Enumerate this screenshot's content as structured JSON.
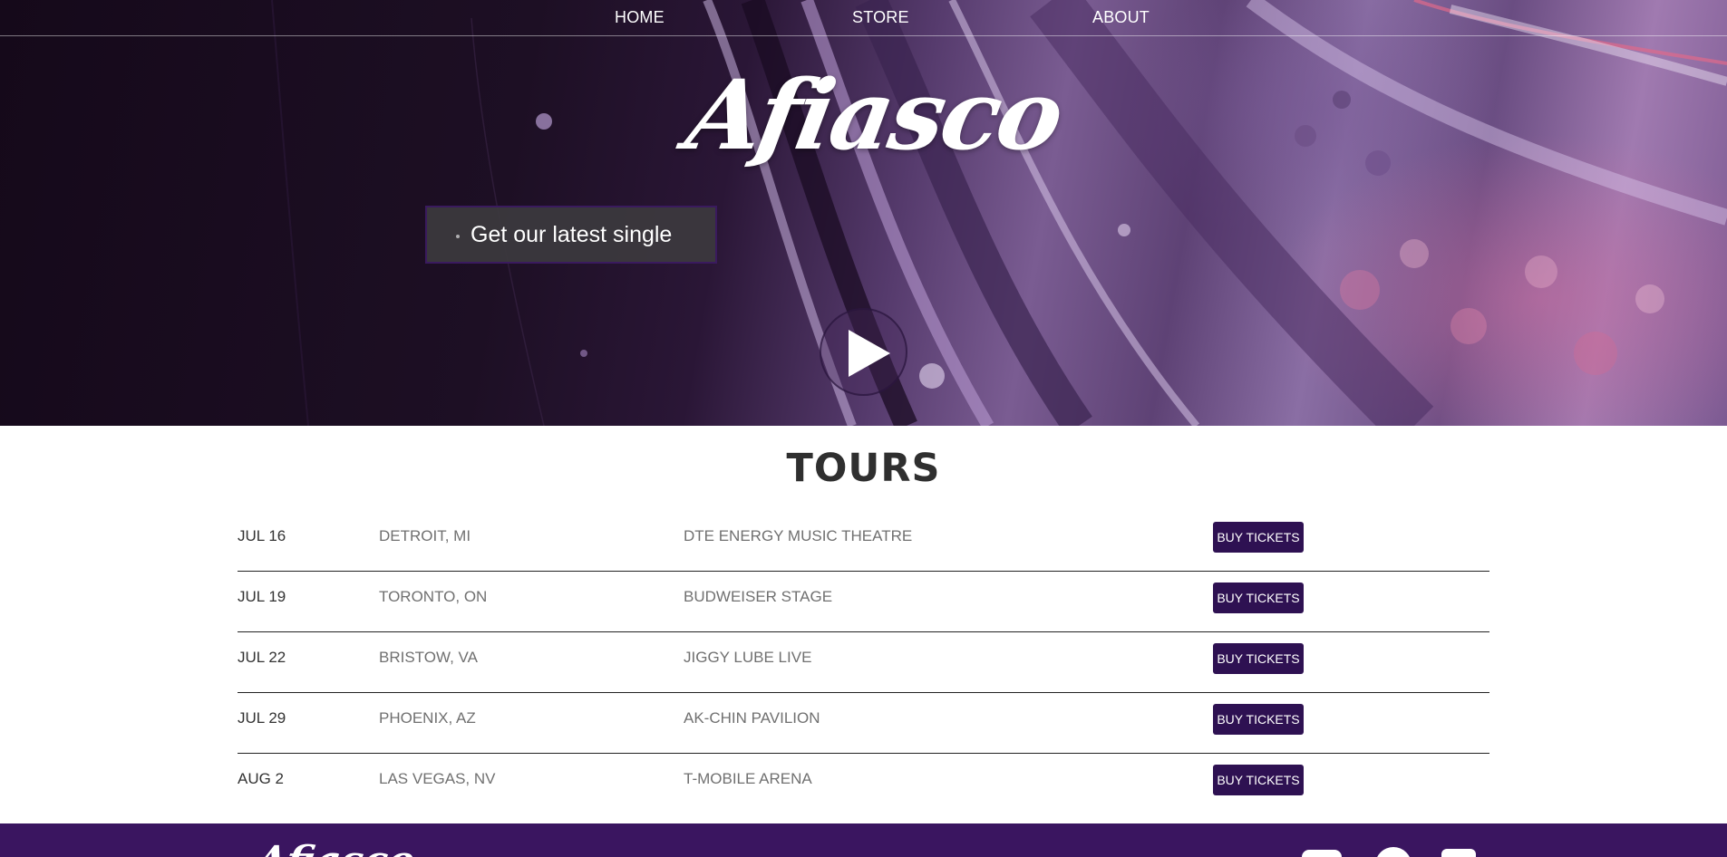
{
  "nav": {
    "home": "HOME",
    "store": "STORE",
    "about": "ABOUT"
  },
  "hero": {
    "logo": "Afiasco",
    "cta_label": "Get our latest single",
    "play_icon": "play-icon"
  },
  "tours": {
    "title": "TOURS",
    "rows": [
      {
        "date": "JUL 16",
        "city": "DETROIT, MI",
        "venue": "DTE ENERGY MUSIC THEATRE",
        "button": "BUY TICKETS"
      },
      {
        "date": "JUL 19",
        "city": "TORONTO, ON",
        "venue": "BUDWEISER STAGE",
        "button": "BUY TICKETS"
      },
      {
        "date": "JUL 22",
        "city": "BRISTOW, VA",
        "venue": "JIGGY LUBE LIVE",
        "button": "BUY TICKETS"
      },
      {
        "date": "JUL 29",
        "city": "PHOENIX, AZ",
        "venue": "AK-CHIN PAVILION",
        "button": "BUY TICKETS"
      },
      {
        "date": "AUG 2",
        "city": "LAS VEGAS, NV",
        "venue": "T-MOBILE ARENA",
        "button": "BUY TICKETS"
      }
    ]
  },
  "footer": {
    "logo": "Afiasco",
    "social_icons": [
      "youtube-icon",
      "pinterest-icon",
      "instagram-icon"
    ]
  },
  "colors": {
    "accent": "#2e1152",
    "footer_bg": "#3a1560",
    "hero_purple": "#7a5c92"
  }
}
